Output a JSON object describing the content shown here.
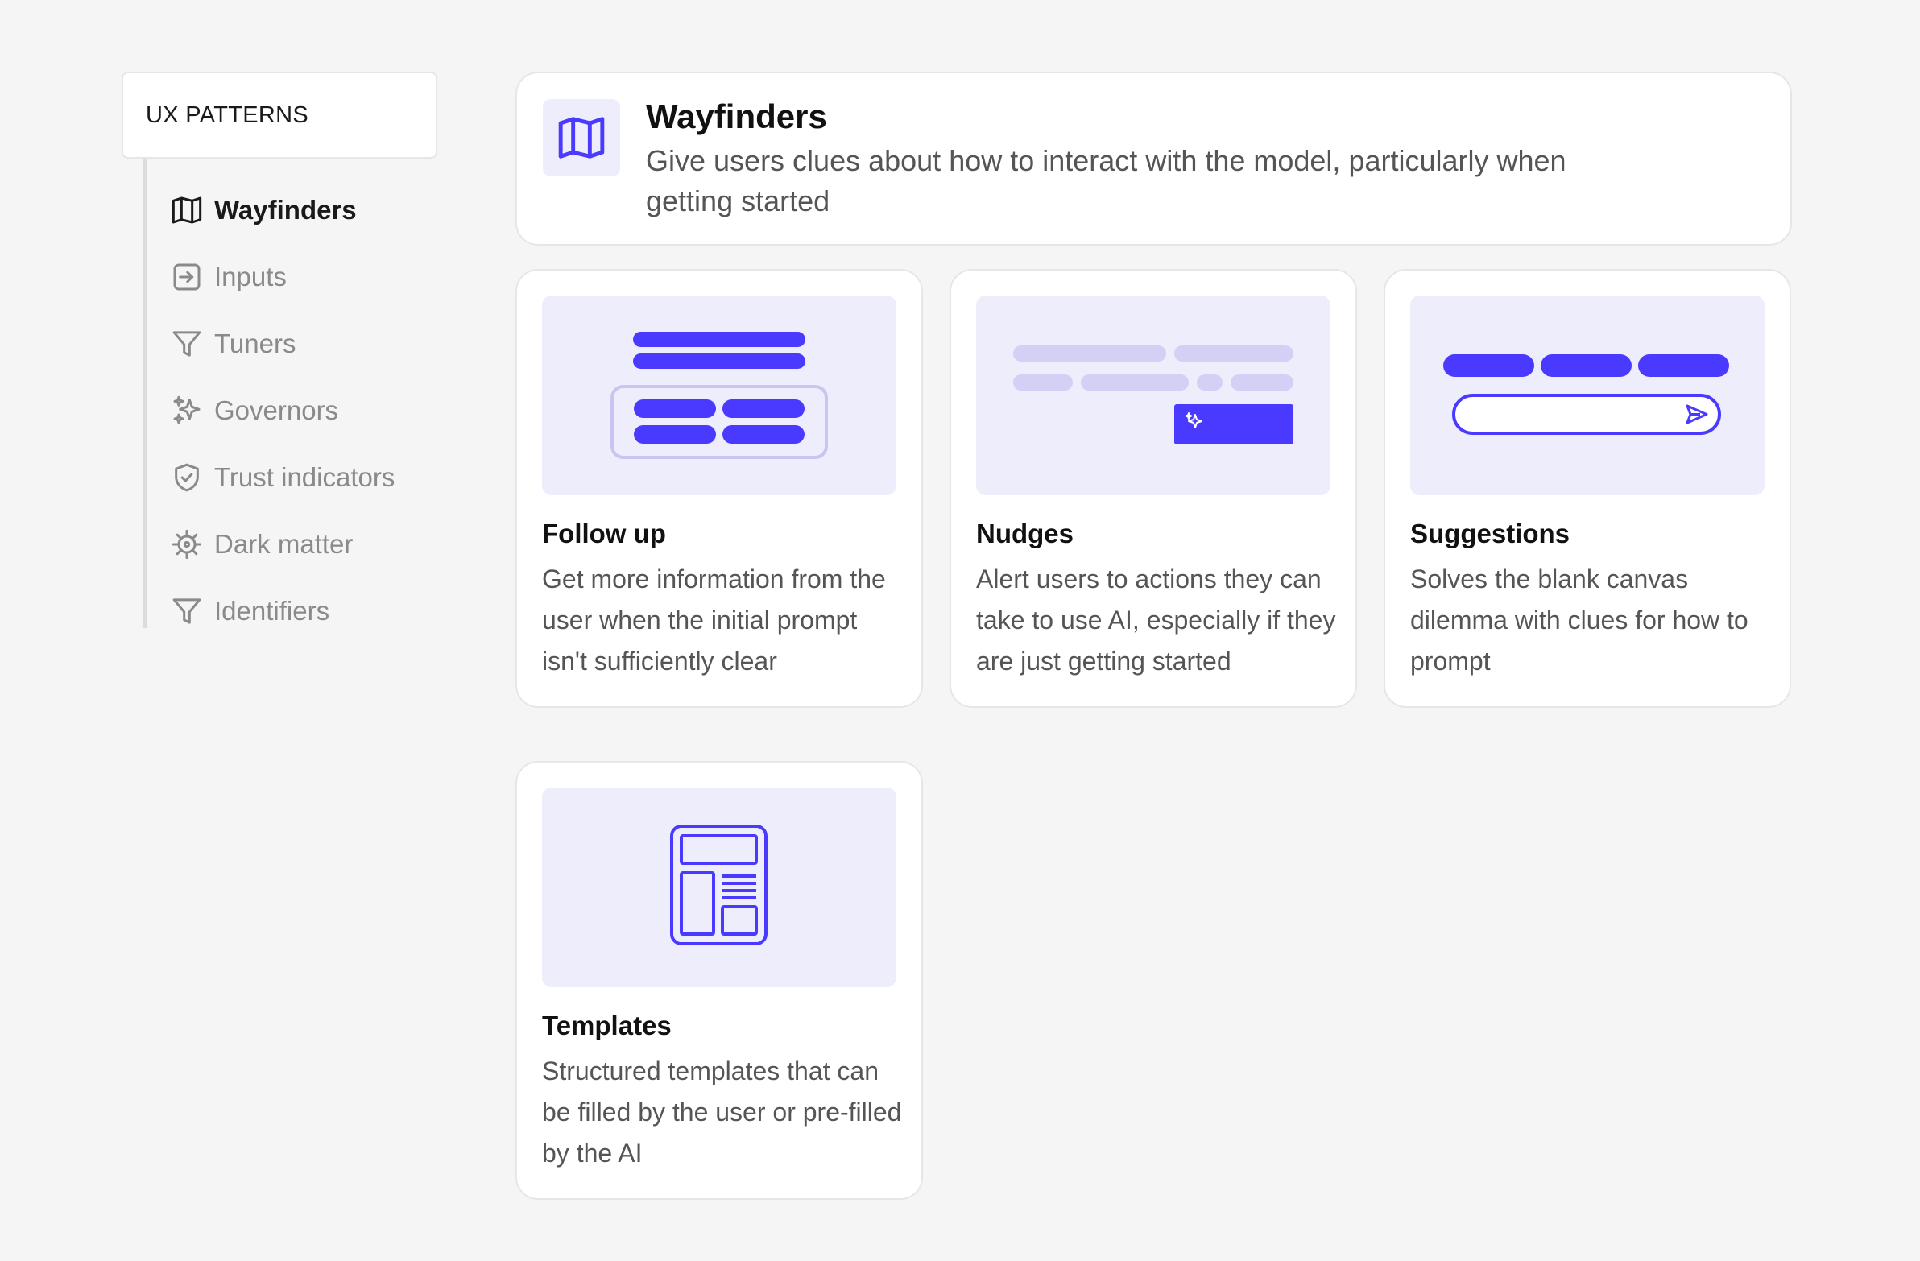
{
  "sidebar": {
    "header": "UX PATTERNS",
    "items": [
      {
        "label": "Wayfinders",
        "icon": "map-icon",
        "active": true
      },
      {
        "label": "Inputs",
        "icon": "arrow-in-box-icon",
        "active": false
      },
      {
        "label": "Tuners",
        "icon": "filter-icon",
        "active": false
      },
      {
        "label": "Governors",
        "icon": "sparkles-icon",
        "active": false
      },
      {
        "label": "Trust indicators",
        "icon": "shield-check-icon",
        "active": false
      },
      {
        "label": "Dark matter",
        "icon": "virus-icon",
        "active": false
      },
      {
        "label": "Identifiers",
        "icon": "filter-icon",
        "active": false
      }
    ]
  },
  "hero": {
    "title": "Wayfinders",
    "description": "Give users clues about how to interact with the model, particularly when getting started",
    "icon": "map-icon"
  },
  "cards": [
    {
      "title": "Follow up",
      "description": "Get more information from the user when the initial prompt isn't sufficiently clear",
      "illustration": "follow-up-illustration"
    },
    {
      "title": "Nudges",
      "description": "Alert users to actions they can take to use AI, especially if they are just getting started",
      "illustration": "nudges-illustration"
    },
    {
      "title": "Suggestions",
      "description": "Solves the blank canvas dilemma with clues for how to prompt",
      "illustration": "suggestions-illustration"
    },
    {
      "title": "Templates",
      "description": "Structured templates that can be filled by the user or pre-filled by the AI",
      "illustration": "templates-illustration"
    }
  ],
  "colors": {
    "accent": "#4a3aff",
    "accent_light": "#d4d0f5",
    "illustration_bg": "#eeedfb",
    "page_bg": "#f5f5f5",
    "active_text": "#1a1a1a",
    "inactive_text": "#8a8a8a"
  }
}
